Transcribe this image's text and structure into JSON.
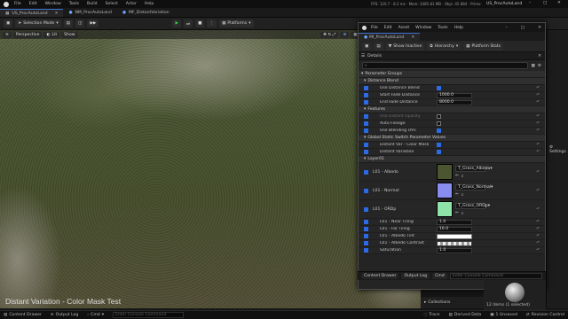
{
  "app": {
    "menu": [
      "File",
      "Edit",
      "Window",
      "Tools",
      "Build",
      "Select",
      "Actor",
      "Help"
    ],
    "project": "US_ProcAutoLand",
    "stats": "FPS: 120.7 · 8.2 ms · Mem: 3485.81 MB · Objs: 45 884 · Prims:"
  },
  "tabs": [
    {
      "label": "US_ProcAutoLand"
    },
    {
      "label": "NM_ProcAutoLand"
    },
    {
      "label": "MF_DistantVariation"
    }
  ],
  "toolbar": {
    "mode": "Selection Mode",
    "platforms": "Platforms"
  },
  "viewport": {
    "perspective": "Perspective",
    "lit": "Lit",
    "show": "Show",
    "grid": "10",
    "angle": "10°",
    "scale": "0.25",
    "speed": "4",
    "overlay": "Distant Variation - Color Mask Test"
  },
  "details_window": {
    "menu": [
      "File",
      "Edit",
      "Asset",
      "Window",
      "Tools",
      "Help"
    ],
    "asset_tab": "MI_ProcAutoLand",
    "show_inactive": "Show Inactive",
    "hierarchy": "Hierarchy",
    "platform_stats": "Platform Stats",
    "panel_title": "Details",
    "search_placeholder": "",
    "groups": {
      "parameter_groups": "Parameter Groups",
      "distance_blend": "Distance Blend",
      "features": "Features",
      "global_switch": "Global Static Switch Parameter Values",
      "layer01": "Layer01"
    },
    "distance_blend": [
      {
        "label": "Use Distance Blend",
        "checked": true
      },
      {
        "label": "Start Fade Distance",
        "value": "1000.0"
      },
      {
        "label": "End Fade Distance",
        "value": "8000.0"
      }
    ],
    "features": [
      {
        "label": "Use Distant Opacity",
        "checked": false
      },
      {
        "label": "Auto Foliage",
        "checked": false
      },
      {
        "label": "Use Blending UVs",
        "checked": true
      }
    ],
    "switches": [
      {
        "label": "Distant Var - Color Mask",
        "checked": true
      },
      {
        "label": "Distant Variation",
        "checked": true
      }
    ],
    "layer_textures": [
      {
        "label": "L01 - Albedo",
        "asset": "T_Grass_Albedo",
        "color": "#4b5530"
      },
      {
        "label": "L01 - Normal",
        "asset": "T_Grass_Normal",
        "color": "#8a8df0"
      },
      {
        "label": "L01 - ORDp",
        "asset": "T_Grass_ORDp",
        "color": "#8ee4a8"
      }
    ],
    "layer_values": [
      {
        "label": "L01 - Near Tiling",
        "value": "1.0"
      },
      {
        "label": "L01 - Far Tiling",
        "value": "16.0"
      },
      {
        "label": "L01 - Albedo Tint",
        "value": ""
      },
      {
        "label": "L01 - Albedo Contrast",
        "value": ""
      },
      {
        "label": "Saturation",
        "value": "1.0"
      }
    ],
    "bottom": {
      "content_drawer": "Content Drawer",
      "output_log": "Output Log",
      "cmd": "Cmd",
      "console_placeholder": "Enter Console Command"
    }
  },
  "right_panel": {
    "settings": "Settings"
  },
  "lower": {
    "collections": "Collections",
    "items": "12 items (1 selected)"
  },
  "statusbar": {
    "content_drawer": "Content Drawer",
    "output_log": "Output Log",
    "cmd": "Cmd",
    "console_placeholder": "Enter Console Command",
    "trace": "Trace",
    "derived_data": "Derived Data",
    "unsaved": "1 Unsaved",
    "revision_control": "Revision Control"
  }
}
